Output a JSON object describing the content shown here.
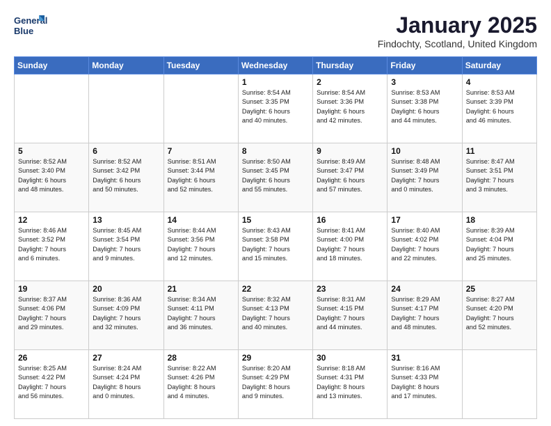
{
  "logo": {
    "line1": "General",
    "line2": "Blue"
  },
  "title": "January 2025",
  "subtitle": "Findochty, Scotland, United Kingdom",
  "weekdays": [
    "Sunday",
    "Monday",
    "Tuesday",
    "Wednesday",
    "Thursday",
    "Friday",
    "Saturday"
  ],
  "weeks": [
    [
      {
        "day": "",
        "info": ""
      },
      {
        "day": "",
        "info": ""
      },
      {
        "day": "",
        "info": ""
      },
      {
        "day": "1",
        "info": "Sunrise: 8:54 AM\nSunset: 3:35 PM\nDaylight: 6 hours\nand 40 minutes."
      },
      {
        "day": "2",
        "info": "Sunrise: 8:54 AM\nSunset: 3:36 PM\nDaylight: 6 hours\nand 42 minutes."
      },
      {
        "day": "3",
        "info": "Sunrise: 8:53 AM\nSunset: 3:38 PM\nDaylight: 6 hours\nand 44 minutes."
      },
      {
        "day": "4",
        "info": "Sunrise: 8:53 AM\nSunset: 3:39 PM\nDaylight: 6 hours\nand 46 minutes."
      }
    ],
    [
      {
        "day": "5",
        "info": "Sunrise: 8:52 AM\nSunset: 3:40 PM\nDaylight: 6 hours\nand 48 minutes."
      },
      {
        "day": "6",
        "info": "Sunrise: 8:52 AM\nSunset: 3:42 PM\nDaylight: 6 hours\nand 50 minutes."
      },
      {
        "day": "7",
        "info": "Sunrise: 8:51 AM\nSunset: 3:44 PM\nDaylight: 6 hours\nand 52 minutes."
      },
      {
        "day": "8",
        "info": "Sunrise: 8:50 AM\nSunset: 3:45 PM\nDaylight: 6 hours\nand 55 minutes."
      },
      {
        "day": "9",
        "info": "Sunrise: 8:49 AM\nSunset: 3:47 PM\nDaylight: 6 hours\nand 57 minutes."
      },
      {
        "day": "10",
        "info": "Sunrise: 8:48 AM\nSunset: 3:49 PM\nDaylight: 7 hours\nand 0 minutes."
      },
      {
        "day": "11",
        "info": "Sunrise: 8:47 AM\nSunset: 3:51 PM\nDaylight: 7 hours\nand 3 minutes."
      }
    ],
    [
      {
        "day": "12",
        "info": "Sunrise: 8:46 AM\nSunset: 3:52 PM\nDaylight: 7 hours\nand 6 minutes."
      },
      {
        "day": "13",
        "info": "Sunrise: 8:45 AM\nSunset: 3:54 PM\nDaylight: 7 hours\nand 9 minutes."
      },
      {
        "day": "14",
        "info": "Sunrise: 8:44 AM\nSunset: 3:56 PM\nDaylight: 7 hours\nand 12 minutes."
      },
      {
        "day": "15",
        "info": "Sunrise: 8:43 AM\nSunset: 3:58 PM\nDaylight: 7 hours\nand 15 minutes."
      },
      {
        "day": "16",
        "info": "Sunrise: 8:41 AM\nSunset: 4:00 PM\nDaylight: 7 hours\nand 18 minutes."
      },
      {
        "day": "17",
        "info": "Sunrise: 8:40 AM\nSunset: 4:02 PM\nDaylight: 7 hours\nand 22 minutes."
      },
      {
        "day": "18",
        "info": "Sunrise: 8:39 AM\nSunset: 4:04 PM\nDaylight: 7 hours\nand 25 minutes."
      }
    ],
    [
      {
        "day": "19",
        "info": "Sunrise: 8:37 AM\nSunset: 4:06 PM\nDaylight: 7 hours\nand 29 minutes."
      },
      {
        "day": "20",
        "info": "Sunrise: 8:36 AM\nSunset: 4:09 PM\nDaylight: 7 hours\nand 32 minutes."
      },
      {
        "day": "21",
        "info": "Sunrise: 8:34 AM\nSunset: 4:11 PM\nDaylight: 7 hours\nand 36 minutes."
      },
      {
        "day": "22",
        "info": "Sunrise: 8:32 AM\nSunset: 4:13 PM\nDaylight: 7 hours\nand 40 minutes."
      },
      {
        "day": "23",
        "info": "Sunrise: 8:31 AM\nSunset: 4:15 PM\nDaylight: 7 hours\nand 44 minutes."
      },
      {
        "day": "24",
        "info": "Sunrise: 8:29 AM\nSunset: 4:17 PM\nDaylight: 7 hours\nand 48 minutes."
      },
      {
        "day": "25",
        "info": "Sunrise: 8:27 AM\nSunset: 4:20 PM\nDaylight: 7 hours\nand 52 minutes."
      }
    ],
    [
      {
        "day": "26",
        "info": "Sunrise: 8:25 AM\nSunset: 4:22 PM\nDaylight: 7 hours\nand 56 minutes."
      },
      {
        "day": "27",
        "info": "Sunrise: 8:24 AM\nSunset: 4:24 PM\nDaylight: 8 hours\nand 0 minutes."
      },
      {
        "day": "28",
        "info": "Sunrise: 8:22 AM\nSunset: 4:26 PM\nDaylight: 8 hours\nand 4 minutes."
      },
      {
        "day": "29",
        "info": "Sunrise: 8:20 AM\nSunset: 4:29 PM\nDaylight: 8 hours\nand 9 minutes."
      },
      {
        "day": "30",
        "info": "Sunrise: 8:18 AM\nSunset: 4:31 PM\nDaylight: 8 hours\nand 13 minutes."
      },
      {
        "day": "31",
        "info": "Sunrise: 8:16 AM\nSunset: 4:33 PM\nDaylight: 8 hours\nand 17 minutes."
      },
      {
        "day": "",
        "info": ""
      }
    ]
  ]
}
